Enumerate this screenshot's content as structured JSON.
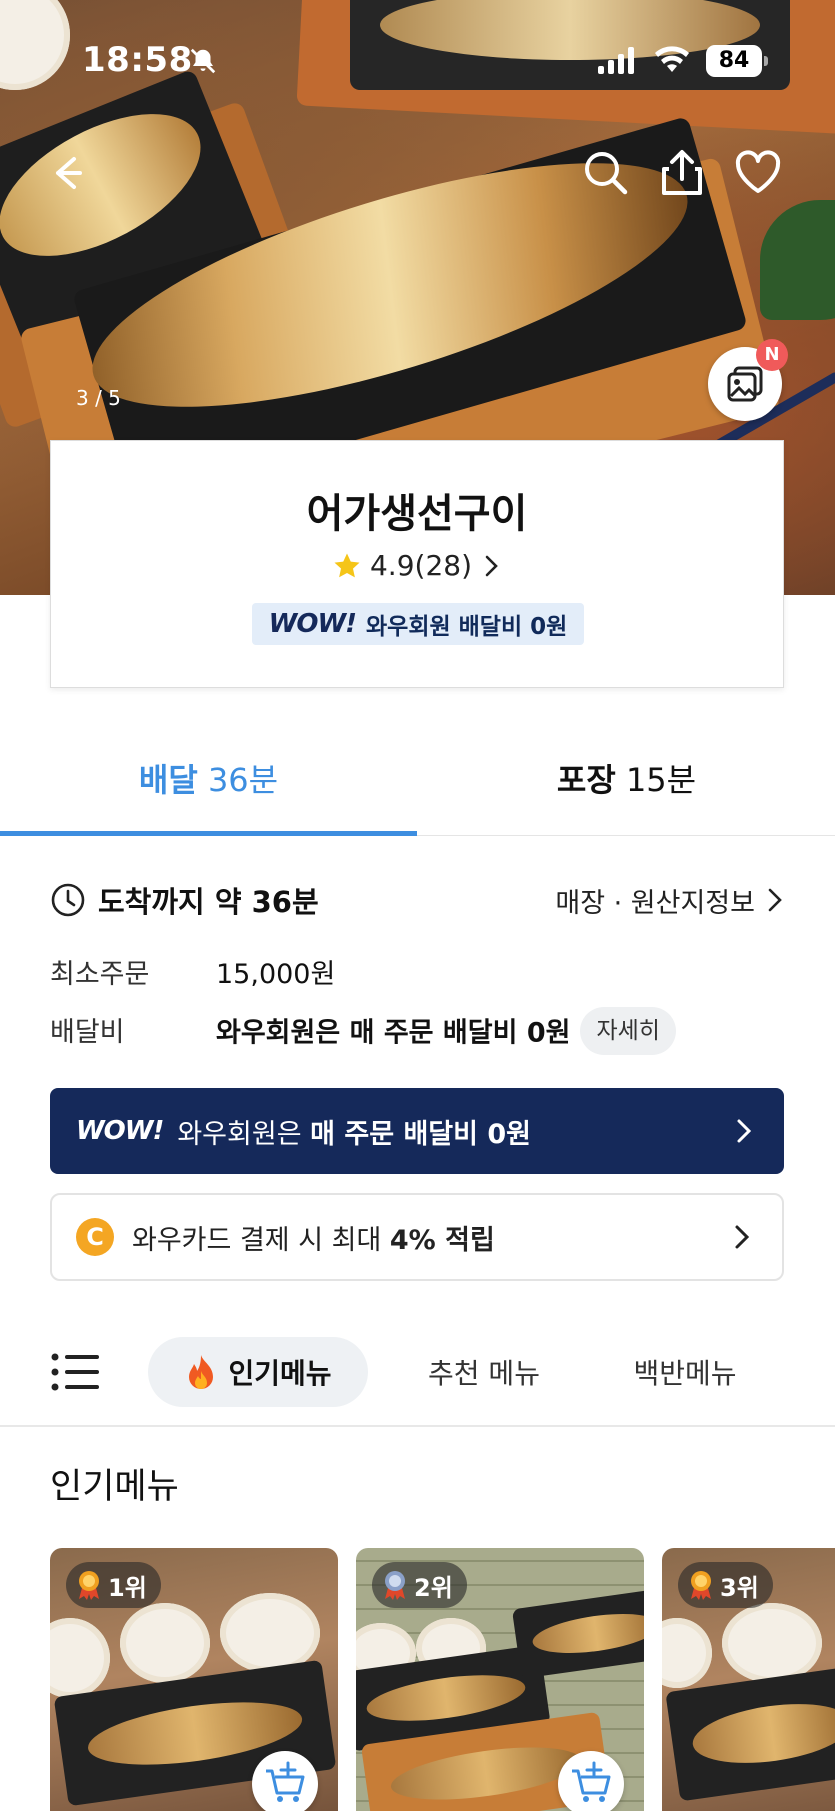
{
  "status_bar": {
    "time": "18:58",
    "battery": "84"
  },
  "hero": {
    "photo_counter": "3 / 5",
    "photo_badge": "N"
  },
  "store": {
    "name": "어가생선구이",
    "rating": "4.9(28)",
    "wow_logo": "WOW!",
    "wow_text": "와우회원 배달비 0원"
  },
  "tabs": [
    {
      "label": "배달",
      "time": "36분",
      "active": true
    },
    {
      "label": "포장",
      "time": "15분",
      "active": false
    }
  ],
  "info": {
    "arrival": "도착까지 약 36분",
    "store_info_link": "매장 · 원산지정보",
    "min_order_label": "최소주문",
    "min_order_value": "15,000원",
    "delivery_fee_label": "배달비",
    "delivery_fee_value": "와우회원은 매 주문 배달비 0원",
    "detail_button": "자세히"
  },
  "wow_banner": {
    "logo": "WOW!",
    "text_plain": "와우회원은 ",
    "text_bold": "매 주문 배달비 0원"
  },
  "card_banner": {
    "coin": "C",
    "text_plain": "와우카드 결제 시 최대 ",
    "text_bold": "4% 적립"
  },
  "categories": [
    {
      "label": "인기메뉴",
      "active": true,
      "icon": "fire-icon"
    },
    {
      "label": "추천 메뉴",
      "active": false
    },
    {
      "label": "백반메뉴",
      "active": false
    }
  ],
  "section": {
    "title": "인기메뉴"
  },
  "popular_items": [
    {
      "rank": "1위",
      "medal_color": "#f0a020"
    },
    {
      "rank": "2위",
      "medal_color": "#8aa0c8"
    },
    {
      "rank": "3위",
      "medal_color": "#f0a020"
    }
  ],
  "colors": {
    "accent": "#3d8ee0",
    "wow_navy": "#15295a",
    "badge_red": "#f05a5a"
  }
}
